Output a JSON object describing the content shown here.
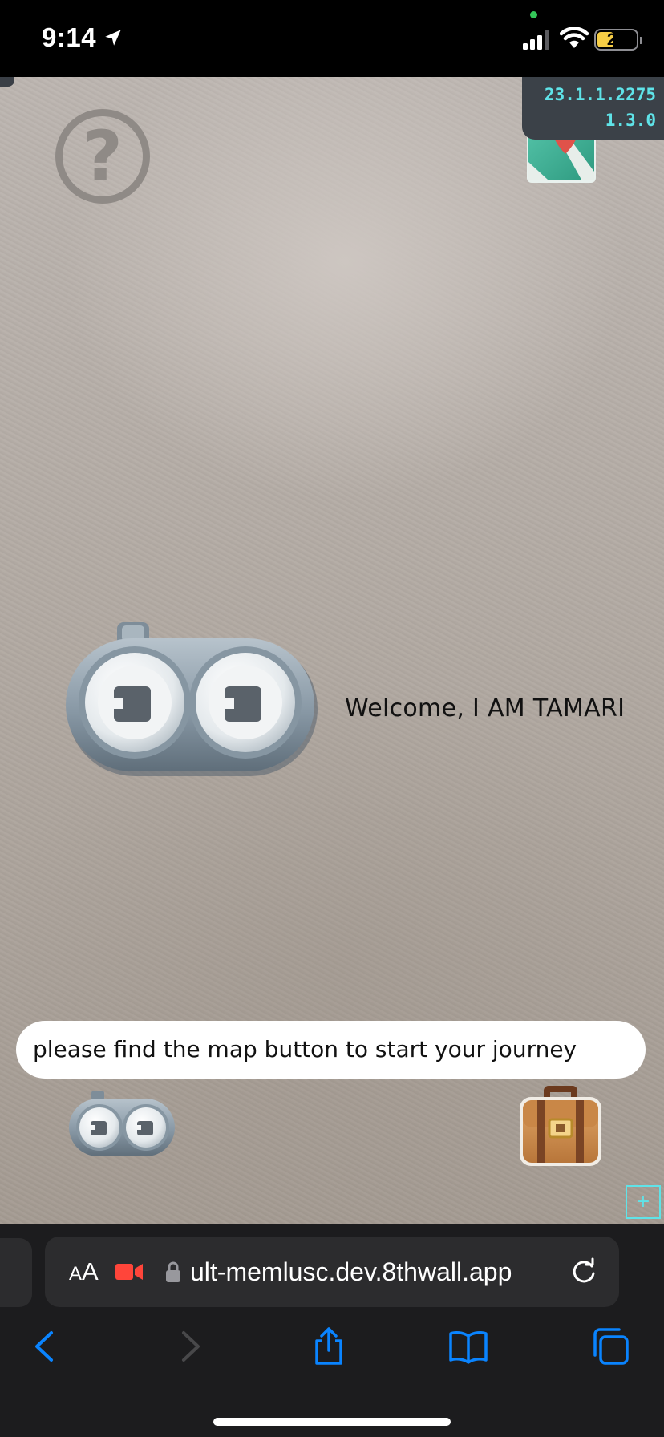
{
  "status_bar": {
    "time": "9:14",
    "battery_level": "21",
    "icons": [
      "location-arrow-icon",
      "signal-icon",
      "wifi-icon",
      "battery-icon"
    ]
  },
  "ar_view": {
    "version": {
      "line1": "23.1.1.2275",
      "line2": "1.3.0"
    },
    "help_glyph": "?",
    "welcome_text": "Welcome, I AM TAMARI",
    "hint_text": "please find the map button to start your journey",
    "debug_plus": "+",
    "icons": [
      "help-icon",
      "map-pin-icon",
      "tamari-robot-icon",
      "briefcase-icon"
    ],
    "colors": {
      "version_text": "#5fe3e8",
      "version_bg": "#3b4148",
      "map_teal": "#3aaa90",
      "pin_red": "#e0524a"
    }
  },
  "browser": {
    "aa_small": "A",
    "aa_big": "A",
    "url": "ult-memlusc.dev.8thwall.app",
    "icons": [
      "camera-recording-icon",
      "lock-icon",
      "reload-icon",
      "back-icon",
      "forward-icon",
      "share-icon",
      "bookmarks-icon",
      "tabs-icon"
    ],
    "colors": {
      "accent": "#0a84ff",
      "recording": "#ff453a"
    }
  }
}
